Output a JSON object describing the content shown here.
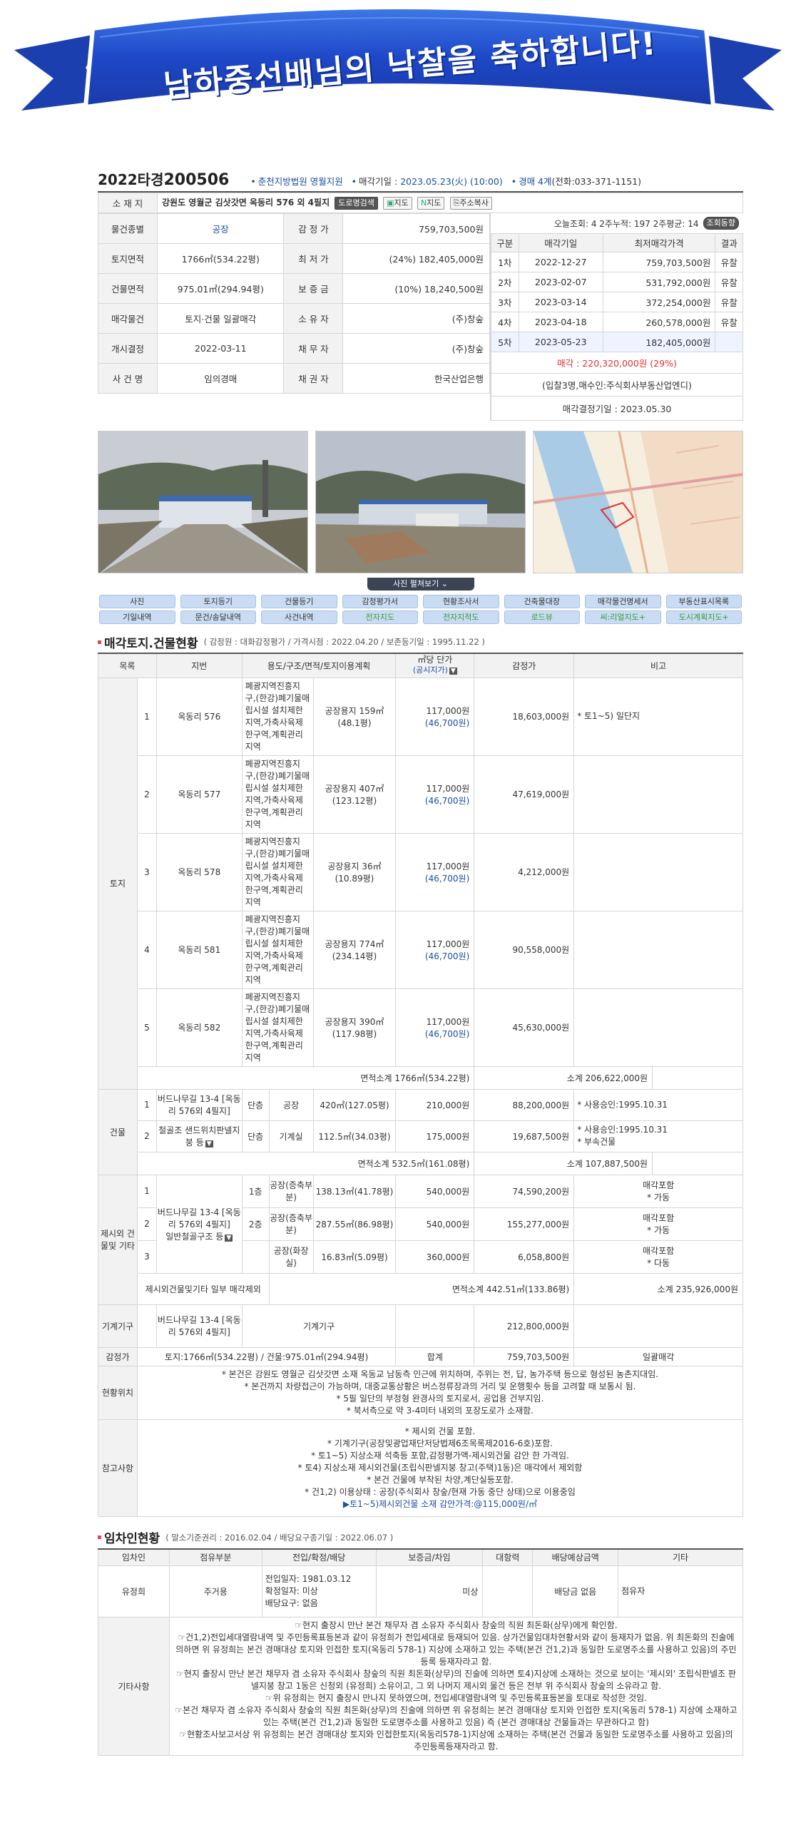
{
  "banner": {
    "text": "남하중선배님의 낙찰을 축하합니다!"
  },
  "case": {
    "year": "2022",
    "type": "타경",
    "number": "200506",
    "court": "춘천지방법원 영월지원",
    "date_label": "매각기일",
    "date_value": "2023.05.23(火) (10:00)",
    "dept": "경매 4계",
    "tel": "(전화:033-371-1151)"
  },
  "address": {
    "label": "소 재 지",
    "value": "강원도 영월군 김삿갓면 옥동리 576 외 4필지",
    "buttons": [
      "도로명검색",
      "지도",
      "지도",
      "주소복사"
    ]
  },
  "stat": {
    "text": "오늘조회: 4  2주누적: 197  2주평균: 14",
    "btn": "조회동향"
  },
  "info": [
    {
      "k1": "물건종별",
      "v1": "공장",
      "k2": "감 정 가",
      "v2": "759,703,500원"
    },
    {
      "k1": "토지면적",
      "v1": "1766㎡(534.22평)",
      "k2": "최 저 가",
      "v2": "(24%) 182,405,000원"
    },
    {
      "k1": "건물면적",
      "v1": "975.01㎡(294.94평)",
      "k2": "보 증 금",
      "v2": "(10%) 18,240,500원"
    },
    {
      "k1": "매각물건",
      "v1": "토지·건물 일괄매각",
      "k2": "소 유 자",
      "v2": "(주)창숲"
    },
    {
      "k1": "개시결정",
      "v1": "2022-03-11",
      "k2": "채 무 자",
      "v2": "(주)창숲"
    },
    {
      "k1": "사 건 명",
      "v1": "임의경매",
      "k2": "채 권 자",
      "v2": "한국산업은행"
    }
  ],
  "rounds": {
    "headers": [
      "구분",
      "매각기일",
      "최저매각가격",
      "결과"
    ],
    "rows": [
      {
        "n": "1차",
        "d": "2022-12-27",
        "p": "759,703,500원",
        "r": "유찰"
      },
      {
        "n": "2차",
        "d": "2023-02-07",
        "p": "531,792,000원",
        "r": "유찰"
      },
      {
        "n": "3차",
        "d": "2023-03-14",
        "p": "372,254,000원",
        "r": "유찰"
      },
      {
        "n": "4차",
        "d": "2023-04-18",
        "p": "260,578,000원",
        "r": "유찰"
      },
      {
        "n": "5차",
        "d": "2023-05-23",
        "p": "182,405,000원",
        "r": ""
      }
    ],
    "sold": "매각 : 220,320,000원 (29%)",
    "bidders": "(입찰3명,매수인:주식회사부동산업엔디)",
    "decision": "매각결정기일 : 2023.05.30"
  },
  "photo_toggle": "사진 펼쳐보기",
  "tabs": [
    "사진",
    "토지등기",
    "건물등기",
    "감정평가서",
    "현황조사서",
    "건축물대장",
    "매각물건명세서",
    "부동산표시목록",
    "기일내역",
    "문건/송달내역",
    "사건내역",
    "전자지도",
    "전자지적도",
    "로드뷰",
    "씨:리얼지도+",
    "도시계획지도+"
  ],
  "appraisal": {
    "title": "매각토지.건물현황",
    "sub": "( 감정원 : 대화감정평가 / 가격시점 : 2022.04.20 / 보존등기일 : 1995.11.22 )",
    "headers": {
      "c1": "목록",
      "c2": "지번",
      "c3": "용도/구조/면적/토지이용계획",
      "c4a": "㎡당 단가",
      "c4b": "(공시지가)",
      "c5": "감정가",
      "c6": "비고"
    },
    "land_label": "토지",
    "zoning": "폐광지역진흥지구,(한강)폐기물매립시설 설치제한지역,가축사육제한구역,계획관리지역",
    "land": [
      {
        "no": "1",
        "lot": "옥동리 576",
        "area": "공장용지 159㎡",
        "py": "(48.1평)",
        "unit": "117,000원",
        "pub": "(46,700원)",
        "amt": "18,603,000원",
        "note": "* 토1~5) 일단지"
      },
      {
        "no": "2",
        "lot": "옥동리 577",
        "area": "공장용지 407㎡",
        "py": "(123.12평)",
        "unit": "117,000원",
        "pub": "(46,700원)",
        "amt": "47,619,000원",
        "note": ""
      },
      {
        "no": "3",
        "lot": "옥동리 578",
        "area": "공장용지 36㎡",
        "py": "(10.89평)",
        "unit": "117,000원",
        "pub": "(46,700원)",
        "amt": "4,212,000원",
        "note": ""
      },
      {
        "no": "4",
        "lot": "옥동리 581",
        "area": "공장용지 774㎡",
        "py": "(234.14평)",
        "unit": "117,000원",
        "pub": "(46,700원)",
        "amt": "90,558,000원",
        "note": ""
      },
      {
        "no": "5",
        "lot": "옥동리 582",
        "area": "공장용지 390㎡",
        "py": "(117.98평)",
        "unit": "117,000원",
        "pub": "(46,700원)",
        "amt": "45,630,000원",
        "note": ""
      }
    ],
    "land_sub_area": "면적소계 1766㎡(534.22평)",
    "land_sub_amt": "소계 206,622,000원",
    "bldg_label": "건물",
    "bldg_lot": "버드나무길 13-4 [옥동리 576외 4필지]",
    "bldg_struct": "철골조 샌드위치판넬지붕 등",
    "bldg": [
      {
        "no": "1",
        "fl": "단층",
        "use": "공장",
        "area": "420㎡(127.05평)",
        "unit": "210,000원",
        "amt": "88,200,000원",
        "note": "* 사용승인:1995.10.31"
      },
      {
        "no": "2",
        "fl": "단층",
        "use": "기계실",
        "area": "112.5㎡(34.03평)",
        "unit": "175,000원",
        "amt": "19,687,500원",
        "note": "* 사용승인:1995.10.31",
        "note2": "* 부속건물"
      }
    ],
    "bldg_sub_area": "면적소계 532.5㎡(161.08평)",
    "bldg_sub_amt": "소계 107,887,500원",
    "ext_label": "제시외 건물및 기타",
    "ext_lot": "버드나무길 13-4 [옥동리 576외 4필지]",
    "ext_struct": "일반철골구조 등",
    "ext": [
      {
        "no": "1",
        "fl": "1층",
        "use": "공장(증축부분)",
        "area": "138.13㎡(41.78평)",
        "unit": "540,000원",
        "amt": "74,590,200원",
        "note": "매각포함",
        "note2": "* 가동"
      },
      {
        "no": "2",
        "fl": "2층",
        "use": "공장(증축부분)",
        "area": "287.55㎡(86.98평)",
        "unit": "540,000원",
        "amt": "155,277,000원",
        "note": "매각포함",
        "note2": "* 가동"
      },
      {
        "no": "3",
        "fl": "",
        "use": "공장(화장실)",
        "area": "16.83㎡(5.09평)",
        "unit": "360,000원",
        "amt": "6,058,800원",
        "note": "매각포함",
        "note2": "* 다동"
      }
    ],
    "ext_sub_label": "제시외건물및기타 일부 매각제외",
    "ext_sub_area": "면적소계 442.51㎡(133.86평)",
    "ext_sub_amt": "소계 235,926,000원",
    "mach_label": "기계기구",
    "mach_lot": "버드나무길 13-4 [옥동리 576외 4필지]",
    "mach_use": "기계기구",
    "mach_amt": "212,800,000원",
    "total_label": "감정가",
    "total_area": "토지:1766㎡(534.22평) / 건물:975.01㎡(294.94평)",
    "total_sum_label": "합계",
    "total_amt": "759,703,500원",
    "total_note": "일괄매각",
    "loc_label": "현황위치",
    "loc": [
      "* 본건은 강원도 영월군 김삿갓면 소재 옥동교 남동측 인근에 위치하며, 주위는 전, 답, 농가주택 등으로 형성된 농촌지대임.",
      "* 본건까지 차량접근이 가능하며, 대중교통상황은 버스정류장과의 거리 및 운행횟수 등을 고려할 때 보통시 됨.",
      "* 5필 일단의 부정형 완경사의 토지로서, 공업용 건부지임.",
      "* 북서측으로 약 3-4미터 내외의 포장도로가 소재함."
    ],
    "ref_label": "참고사항",
    "ref": [
      "* 제시외 건물 포함.",
      "* 기계기구(공장및광업재단저당법제6조목록제2016-6호)포함.",
      "* 토1~5) 지상소재 석축등 포함,감정평가액-제시외건물 감안 한 가격임.",
      "* 토4) 지상소재 제시외건물(조립식판넬지붕 창고(주택)1동)은 매각에서 제외함",
      "* 본건 건물에 부착된 차양,계단실등포함.",
      "* 건1,2) 이용상태 : 공장(주식회사 창숲/현재 가동 중단 상태)으로 이용중임"
    ],
    "ref_link": "▶토1~5)제시외건물 소재 감안가격:@115,000원/㎡"
  },
  "tenant": {
    "title": "임차인현황",
    "sub": "( 말소기준권리 : 2016.02.04 / 배당요구종기일 : 2022.06.07 )",
    "headers": [
      "임차인",
      "점유부분",
      "전입/확정/배당",
      "보증금/차임",
      "대항력",
      "배당예상금액",
      "기타"
    ],
    "row": {
      "name": "유정희",
      "part": "주거용",
      "d1": "전입일자: 1981.03.12",
      "d2": "확정일자: 미상",
      "d3": "배당요구: 없음",
      "dep": "미상",
      "opp": "",
      "exp": "배당금 없음",
      "etc": "점유자"
    },
    "etc_label": "기타사항",
    "etc": [
      "☞현지 출장시 만난 본건 채무자 겸 소유자 주식회사 창숲의 직원 최돈화(상무)에게 확인함.",
      "☞건1,2)전입세대열람내역 및 주민등록표등본과 같이 유정희가 전입세대로 등재되어 있음. 상가건물임대차현황서와 같이 등재자가 없음. 위 최돈화의 진술에 의하면 위 유정희는 본건 경매대상 토지와 인접한 토지(옥동리 578-1) 지상에 소재하고 있는 주택(본건 건1,2)과 동일한 도로명주소를 사용하고 있음)의 주민등록 등재자라고 함.",
      "☞현지 출장시 만난 본건 채무자 겸 소유자 주식회사 창숲의 직원 최돈화(상무)의 진술에 의하면 토4)지상에 소재하는 것으로 보이는 '제시외' 조립식판넬조 판넬지붕 창고 1동은 신청외 (유정희) 소유이고, 그 외 나머지 제시외 물건 등은 전부 위 주식회사 창숲의 소유라고 함.",
      "☞위 유정희는 현지 출장시 만나지 못하였으며, 전입세대열람내역 및 주민등록표등본을 토대로 작성한 것임.",
      "☞본건 채무자 겸 소유자 주식회사 창숲의 직원 최돈화(상무)의 진술에 의하면 위 유정희는 본건 경매대상 토지와 인접한 토지(옥동리 578-1) 지상에 소재하고 있는 주택(본건 건1,2)과 동일한 도로명주소를 사용하고 있음) 즉 (본건 경매대상 건물들과는 무관하다고 함)",
      "☞현황조사보고서상 위 유정희는 본건 경매대상 토지와 인접한토지(옥동리578-1)지상에 소재하는 주택(본건 건물과 동일한 도로명주소를 사용하고 있음)의 주민등록등재자라고 함."
    ]
  }
}
